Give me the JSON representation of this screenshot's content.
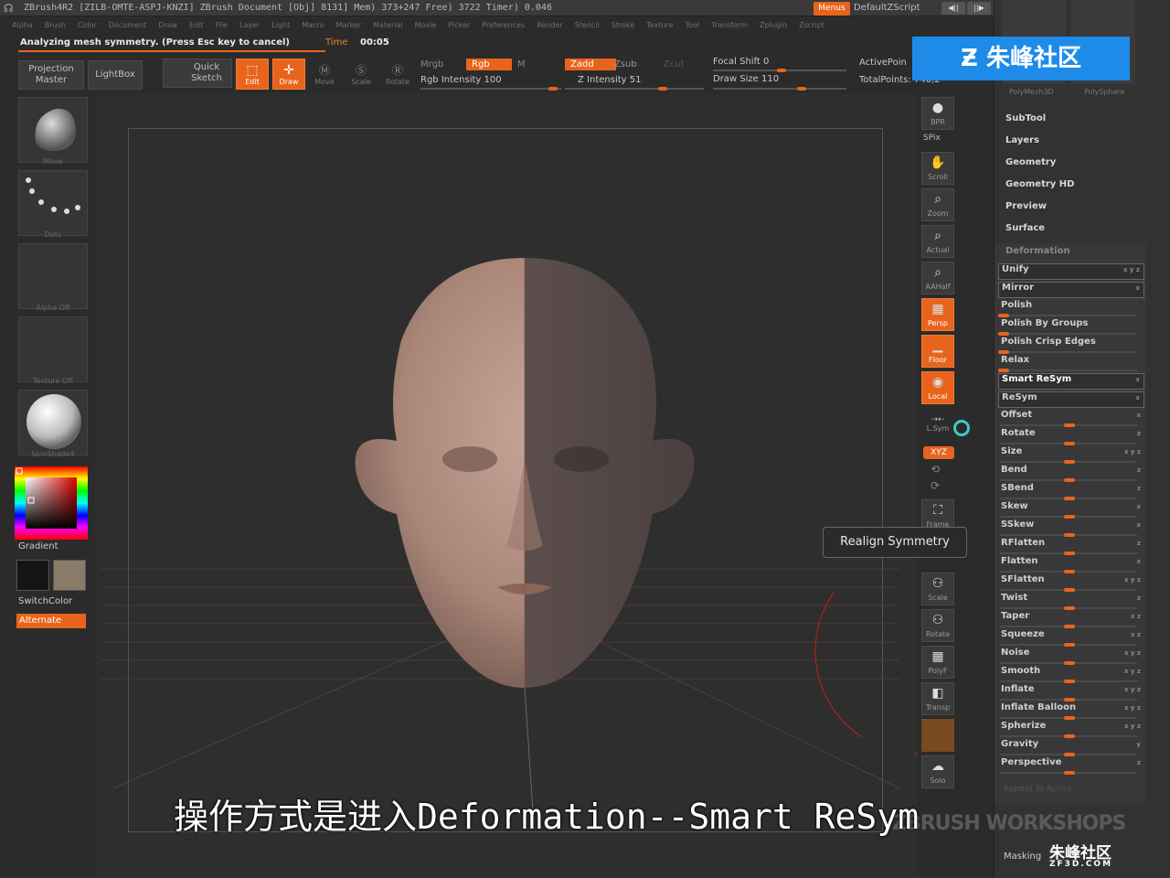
{
  "titlebar": {
    "text": "ZBrush4R2  [ZILB-OMTE-ASPJ-KNZI]     ZBrush Document     [Obj] 8131] Mem) 373+247  Free) 3722  Timer) 0.046",
    "menus_label": "Menus",
    "default_zscript": "DefaultZScript"
  },
  "menubar": [
    "Alpha",
    "Brush",
    "Color",
    "Document",
    "Draw",
    "Edit",
    "File",
    "Layer",
    "Light",
    "Macro",
    "Marker",
    "Material",
    "Movie",
    "Picker",
    "Preferences",
    "Render",
    "Stencil",
    "Stroke",
    "Texture",
    "Tool",
    "Transform",
    "Zplugin",
    "Zscript"
  ],
  "status": {
    "analyzing": "Analyzing mesh symmetry. (Press Esc key to cancel)",
    "time_label": "Time",
    "time_value": "00:05"
  },
  "toolbar": {
    "projection_master": "Projection Master",
    "lightbox": "LightBox",
    "quick_sketch": "Quick Sketch",
    "edit": "Edit",
    "draw": "Draw",
    "move": "Move",
    "scale": "Scale",
    "rotate": "Rotate",
    "mrgb": "Mrgb",
    "rgb": "Rgb",
    "m": "M",
    "rgb_intensity": "Rgb Intensity 100",
    "zadd": "Zadd",
    "zsub": "Zsub",
    "zcut": "Zcut",
    "z_intensity": "Z Intensity 51",
    "focal_shift": "Focal Shift 0",
    "draw_size": "Draw Size 110",
    "active_points": "ActivePoin",
    "total_points": "TotalPoints: 740,2"
  },
  "left_shelf": {
    "brush_label": "Move",
    "stroke_label": "Dots",
    "alpha_label": "Alpha Off",
    "texture_label": "Texture Off",
    "material_label": "SkinShade4",
    "gradient": "Gradient",
    "switch_color": "SwitchColor",
    "alternate": "Alternate"
  },
  "right_shelf": {
    "bpr": "BPR",
    "spix": "SPix",
    "scroll": "Scroll",
    "zoom": "Zoom",
    "actual": "Actual",
    "aahalf": "AAHalf",
    "persp": "Persp",
    "floor": "Floor",
    "local": "Local",
    "lsym": "L.Sym",
    "xyz": "XYZ",
    "frame": "Frame",
    "scale": "Scale",
    "rotate": "Rotate",
    "polyf": "PolyF",
    "transp": "Transp",
    "solo": "Solo"
  },
  "tooltip": "Realign Symmetry",
  "right_panel": {
    "thumb1": "PolyMesh3D",
    "thumb2": "PolySphere",
    "subtool": "SubTool",
    "layers": "Layers",
    "geometry": "Geometry",
    "geometry_hd": "Geometry HD",
    "preview": "Preview",
    "surface": "Surface",
    "deformation": "Deformation",
    "masking": "Masking",
    "repeat_to_active": "Repeat To Active",
    "deform_items": [
      {
        "label": "Unify",
        "axes": "x y z"
      },
      {
        "label": "Mirror",
        "axes": "x"
      },
      {
        "label": "Polish",
        "axes": ""
      },
      {
        "label": "Polish By Groups",
        "axes": ""
      },
      {
        "label": "Polish Crisp Edges",
        "axes": ""
      },
      {
        "label": "Relax",
        "axes": ""
      },
      {
        "label": "Smart ReSym",
        "axes": "x"
      },
      {
        "label": "ReSym",
        "axes": "x"
      },
      {
        "label": "Offset",
        "axes": "x"
      },
      {
        "label": "Rotate",
        "axes": "z"
      },
      {
        "label": "Size",
        "axes": "x y z"
      },
      {
        "label": "Bend",
        "axes": "z"
      },
      {
        "label": "SBend",
        "axes": "z"
      },
      {
        "label": "Skew",
        "axes": "x"
      },
      {
        "label": "SSkew",
        "axes": "x"
      },
      {
        "label": "RFlatten",
        "axes": "z"
      },
      {
        "label": "Flatten",
        "axes": "x"
      },
      {
        "label": "SFlatten",
        "axes": "x y z"
      },
      {
        "label": "Twist",
        "axes": "z"
      },
      {
        "label": "Taper",
        "axes": "x z"
      },
      {
        "label": "Squeeze",
        "axes": "x z"
      },
      {
        "label": "Noise",
        "axes": "x y z"
      },
      {
        "label": "Smooth",
        "axes": "x y z"
      },
      {
        "label": "Inflate",
        "axes": "x y z"
      },
      {
        "label": "Inflate Balloon",
        "axes": "x y z"
      },
      {
        "label": "Spherize",
        "axes": "x y z"
      },
      {
        "label": "Gravity",
        "axes": "y"
      },
      {
        "label": "Perspective",
        "axes": "z"
      }
    ]
  },
  "watermark": {
    "top": "朱峰社区",
    "bottom": "朱峰社区",
    "bottom_url": "ZF3D.COM",
    "workshops": "ZBRUSH WORKSHOPS"
  },
  "subtitle": "操作方式是进入Deformation--Smart ReSym",
  "colors": {
    "accent": "#e8641d",
    "panel": "#323232",
    "background": "#2b2b2b",
    "watermark_blue": "#1e8be8"
  }
}
